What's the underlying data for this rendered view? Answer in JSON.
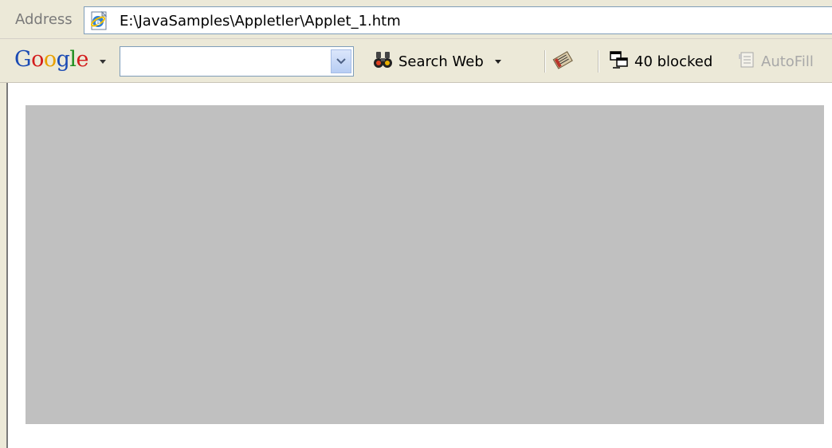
{
  "address_bar": {
    "label": "Address",
    "url": "E:\\JavaSamples\\Appletler\\Applet_1.htm"
  },
  "google_toolbar": {
    "logo_text": "Google",
    "search_value": "",
    "search_web_label": "Search Web",
    "blocked_label": "40 blocked",
    "autofill_label": "AutoFill"
  },
  "icons": {
    "page_icon": "ie-page-icon",
    "search_web": "binoculars-icon",
    "news": "news-icon",
    "popup_blocker": "popup-blocker-icon",
    "autofill": "autofill-icon"
  },
  "colors": {
    "chrome": "#ece9d8",
    "applet_bg": "#c0c0c0",
    "input_border": "#7f9db9"
  }
}
